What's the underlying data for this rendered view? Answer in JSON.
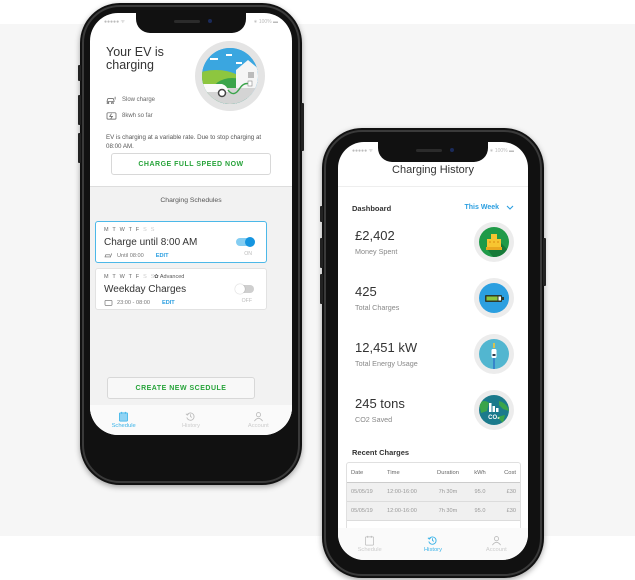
{
  "status_bar": {
    "signal": "●●●●● ᯤ",
    "battery": "∗ 100% ▬"
  },
  "phone1": {
    "hero_title": "Your EV is charging",
    "info_rows": [
      {
        "icon": "car-charge-icon",
        "text": "Slow charge"
      },
      {
        "icon": "energy-icon",
        "text": "8kwh so far"
      }
    ],
    "description": "EV is charging at a variable rate. Due to stop charging at 08:00 AM.",
    "charge_full_button": "CHARGE FULL SPEED NOW",
    "schedules_heading": "Charging Schedules",
    "schedules": [
      {
        "days_on": "M T W T F",
        "days_off": "S S",
        "advanced": "",
        "title": "Charge until 8:00 AM",
        "sub": "Until 08:00",
        "edit": "EDIT",
        "state": "ON",
        "enabled": true
      },
      {
        "days_on": "M T W T F",
        "days_off": "S S",
        "advanced": "Advanced",
        "title": "Weekday Charges",
        "sub": "23:00 - 08:00",
        "edit": "EDIT",
        "state": "OFF",
        "enabled": false
      }
    ],
    "create_button": "CREATE NEW SCEDULE",
    "tabs": [
      {
        "label": "Schedule",
        "icon": "calendar-icon",
        "active": true
      },
      {
        "label": "History",
        "icon": "history-icon",
        "active": false
      },
      {
        "label": "Account",
        "icon": "user-icon",
        "active": false
      }
    ]
  },
  "phone2": {
    "title": "Charging History",
    "dashboard_label": "Dashboard",
    "period_select": "This Week",
    "stats": [
      {
        "value": "£2,402",
        "label": "Money Spent",
        "icon": "cash-register-icon",
        "color": "#1f9a48"
      },
      {
        "value": "425",
        "label": "Total Charges",
        "icon": "battery-icon",
        "color": "#2b9fe0"
      },
      {
        "value": "12,451 kW",
        "label": "Total Energy Usage",
        "icon": "plug-icon",
        "color": "#52b6d0"
      },
      {
        "value": "245 tons",
        "label": "CO2 Saved",
        "icon": "co2-globe-icon",
        "color": "#1b7a8c"
      }
    ],
    "recent_label": "Recent Charges",
    "table": {
      "headers": [
        "Date",
        "Time",
        "Duration",
        "kWh",
        "Cost"
      ],
      "rows": [
        [
          "05/05/19",
          "12:00-16:00",
          "7h 30m",
          "95.0",
          "£30"
        ],
        [
          "05/05/19",
          "12:00-16:00",
          "7h 30m",
          "95.0",
          "£30"
        ]
      ]
    },
    "tabs": [
      {
        "label": "Schedule",
        "icon": "calendar-icon",
        "active": false
      },
      {
        "label": "History",
        "icon": "history-icon",
        "active": true
      },
      {
        "label": "Account",
        "icon": "user-icon",
        "active": false
      }
    ]
  },
  "colors": {
    "accent": "#2a9ee0",
    "green_action": "#27a33a"
  }
}
